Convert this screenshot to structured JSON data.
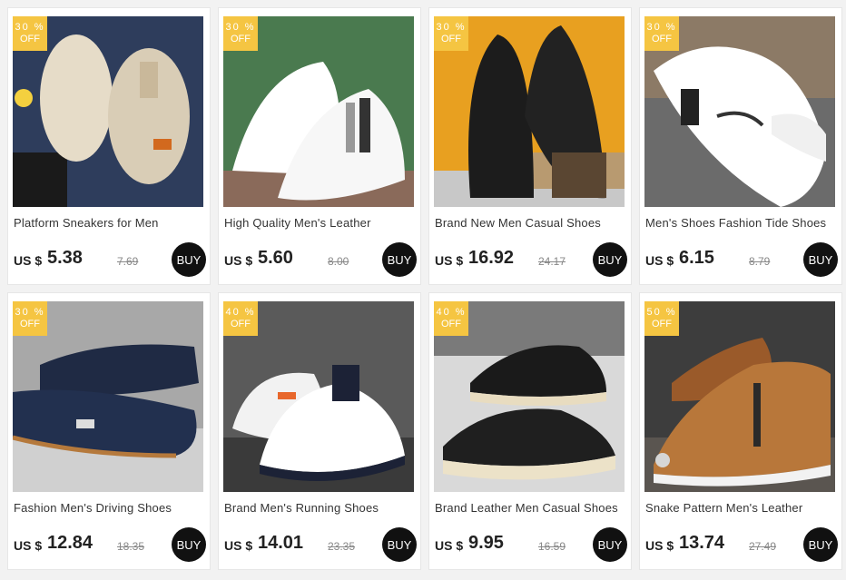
{
  "colors": {
    "badge": "#f5c542",
    "buy": "#111111",
    "page_bg": "#f2f2f2"
  },
  "currency_label": "US $",
  "buy_label": "BUY",
  "products": [
    {
      "title": "Platform Sneakers for Men",
      "price": "5.38",
      "old_price": "7.69",
      "discount_pct": "30 %",
      "discount_off": "OFF"
    },
    {
      "title": "High Quality Men's Leather",
      "price": "5.60",
      "old_price": "8.00",
      "discount_pct": "30 %",
      "discount_off": "OFF"
    },
    {
      "title": "Brand New Men Casual Shoes",
      "price": "16.92",
      "old_price": "24.17",
      "discount_pct": "30 %",
      "discount_off": "OFF"
    },
    {
      "title": "Men's Shoes Fashion Tide Shoes",
      "price": "6.15",
      "old_price": "8.79",
      "discount_pct": "30 %",
      "discount_off": "OFF"
    },
    {
      "title": "Fashion Men's Driving Shoes",
      "price": "12.84",
      "old_price": "18.35",
      "discount_pct": "30 %",
      "discount_off": "OFF"
    },
    {
      "title": "Brand Men's Running Shoes",
      "price": "14.01",
      "old_price": "23.35",
      "discount_pct": "40 %",
      "discount_off": "OFF"
    },
    {
      "title": "Brand Leather Men Casual Shoes",
      "price": "9.95",
      "old_price": "16.59",
      "discount_pct": "40 %",
      "discount_off": "OFF"
    },
    {
      "title": "Snake Pattern Men's Leather",
      "price": "13.74",
      "old_price": "27.49",
      "discount_pct": "50 %",
      "discount_off": "OFF"
    }
  ]
}
